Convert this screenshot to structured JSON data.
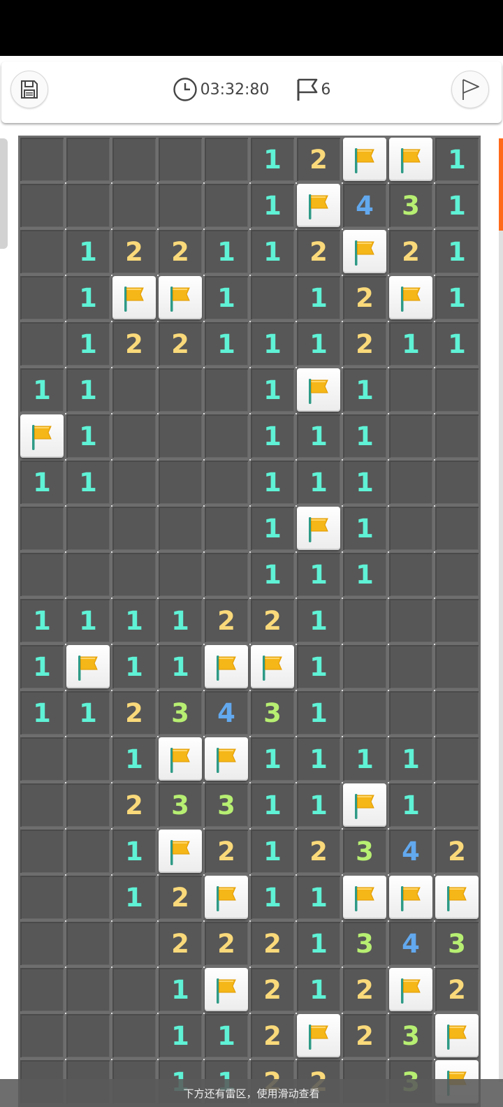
{
  "header": {
    "timer": "03:32:80",
    "flag_count": "6",
    "icons": {
      "save": "save-icon",
      "clock": "clock-icon",
      "flag": "flag-icon",
      "flag_mode": "flag-outline-icon"
    }
  },
  "board": {
    "columns": 10,
    "legend": {
      "F": "flagged",
      ".": "revealed-empty",
      "digits": "adjacent mine count"
    },
    "rows": [
      ".....12FF1",
      ".....1F431",
      ".122112F21",
      ".1FF1.12F1",
      ".122111211",
      "11...1F1..",
      "F1...111..",
      "11...111..",
      ".....1F1..",
      ".....111..",
      "1111221...",
      "1F11FF1...",
      "1123431...",
      "..1FF1111.",
      "..23311F1.",
      "..1F212342",
      "..12F11FFF",
      "...2221343",
      "...1F212F2",
      "...112F23F",
      "...1122.3F"
    ],
    "number_colors": {
      "1": "#5ff2d6",
      "2": "#f9d97a",
      "3": "#b7ef72",
      "4": "#62a9ef"
    },
    "flag_color": "#f5b617"
  },
  "toast": "下方还有雷区，使用滑动查看"
}
